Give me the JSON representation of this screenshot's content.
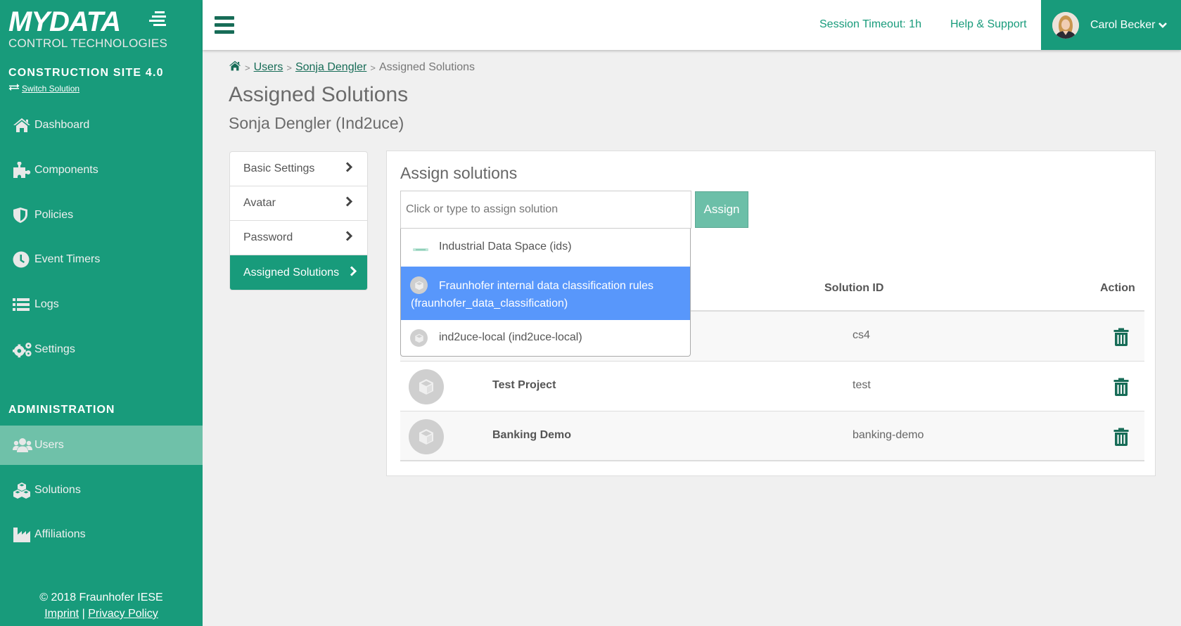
{
  "brand": {
    "logo_main": "MYDATA",
    "logo_sub": "CONTROL TECHNOLOGIES",
    "primary_color": "#189b7b",
    "dark_color": "#176c57",
    "highlight_color": "#5897fb"
  },
  "sidebar": {
    "solution_name": "CONSTRUCTION SITE 4.0",
    "switch_label": "Switch Solution",
    "switch_icon": "exchange-icon",
    "items": [
      {
        "label": "Dashboard",
        "icon": "home-icon"
      },
      {
        "label": "Components",
        "icon": "puzzle-icon"
      },
      {
        "label": "Policies",
        "icon": "shield-icon"
      },
      {
        "label": "Event Timers",
        "icon": "clock-icon"
      },
      {
        "label": "Logs",
        "icon": "list-icon"
      },
      {
        "label": "Settings",
        "icon": "gears-icon"
      }
    ],
    "admin_heading": "ADMINISTRATION",
    "admin_items": [
      {
        "label": "Users",
        "icon": "users-icon",
        "active": true
      },
      {
        "label": "Solutions",
        "icon": "cubes-icon"
      },
      {
        "label": "Affiliations",
        "icon": "industry-icon"
      }
    ],
    "footer": {
      "copyright": "© 2018 Fraunhofer IESE",
      "imprint": "Imprint",
      "separator": "|",
      "privacy": "Privacy Policy"
    }
  },
  "header": {
    "session_timeout": "Session Timeout: 1h",
    "help": "Help & Support",
    "user_name": "Carol Becker"
  },
  "breadcrumb": {
    "home_icon": "home-icon",
    "separator": ">",
    "items": [
      "Users",
      "Sonja Dengler",
      "Assigned Solutions"
    ]
  },
  "page": {
    "title": "Assigned Solutions",
    "subtitle": "Sonja Dengler (Ind2uce)"
  },
  "settings_nav": [
    {
      "label": "Basic Settings",
      "active": false
    },
    {
      "label": "Avatar",
      "active": false
    },
    {
      "label": "Password",
      "active": false
    },
    {
      "label": "Assigned Solutions",
      "active": true
    }
  ],
  "assign": {
    "title": "Assign solutions",
    "input_placeholder": "Click or type to assign solution",
    "input_value": "",
    "button_label": "Assign",
    "dropdown_options": [
      {
        "label": "Industrial Data Space (ids)",
        "highlighted": false
      },
      {
        "label": "Fraunhofer internal data classification rules (fraunhofer_data_classification)",
        "highlighted": true
      },
      {
        "label": "ind2uce-local (ind2uce-local)",
        "highlighted": false
      }
    ]
  },
  "table": {
    "columns": [
      "",
      "",
      "Solution ID",
      "Action"
    ],
    "rows": [
      {
        "name": "",
        "solution_id": "cs4"
      },
      {
        "name": "Test Project",
        "solution_id": "test"
      },
      {
        "name": "Banking Demo",
        "solution_id": "banking-demo"
      }
    ]
  }
}
